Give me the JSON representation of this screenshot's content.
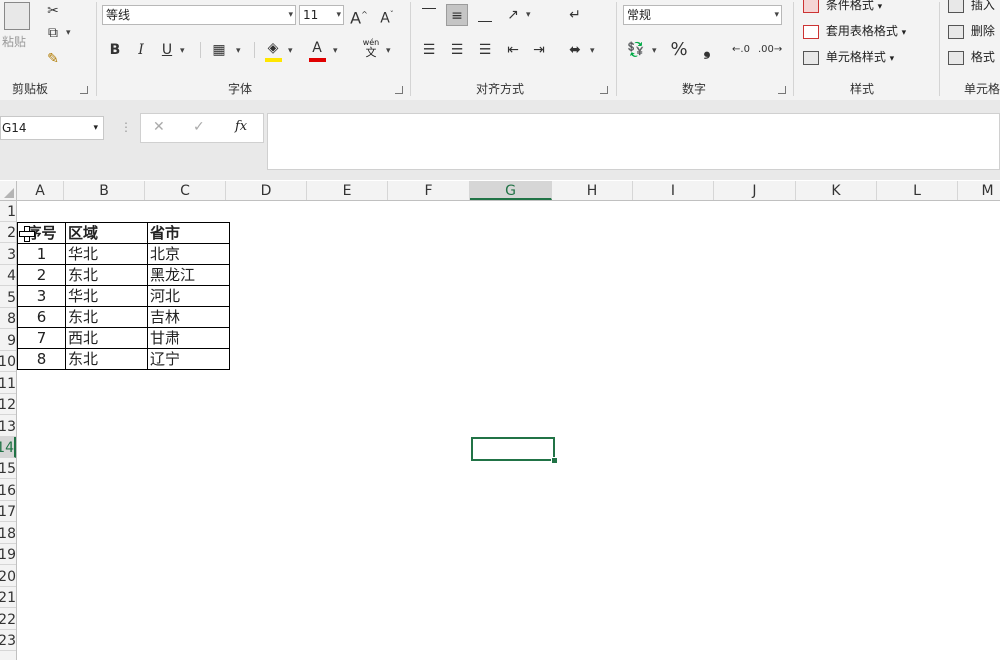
{
  "ribbon": {
    "clipboard": {
      "paste_label": "粘贴",
      "group_label": "剪贴板"
    },
    "font": {
      "family": "等线",
      "size": "11",
      "grow": "A",
      "shrink": "A",
      "bold": "B",
      "italic": "I",
      "underline": "U",
      "phonetic_top": "wén",
      "phonetic_bottom": "文",
      "group_label": "字体"
    },
    "alignment": {
      "group_label": "对齐方式"
    },
    "number": {
      "format": "常规",
      "percent": "%",
      "comma": "❟",
      "group_label": "数字"
    },
    "styles": {
      "conditional": "条件格式",
      "table_format": "套用表格格式",
      "cell_styles": "单元格样式",
      "group_label": "样式"
    },
    "cells": {
      "insert": "插入",
      "delete": "删除",
      "format": "格式",
      "group_label": "单元格"
    }
  },
  "formula_bar": {
    "name_box": "G14",
    "cancel": "✕",
    "enter": "✓",
    "fx": "fx",
    "formula": ""
  },
  "columns": [
    "A",
    "B",
    "C",
    "D",
    "E",
    "F",
    "G",
    "H",
    "I",
    "J",
    "K",
    "L",
    "M"
  ],
  "active_column": "G",
  "rows": [
    "1",
    "2",
    "3",
    "4",
    "5",
    "8",
    "9",
    "10",
    "11",
    "12",
    "13",
    "14",
    "15",
    "16",
    "17",
    "18",
    "19",
    "20",
    "21",
    "22",
    "23"
  ],
  "active_row": "14",
  "table": {
    "headers": [
      "序号",
      "区域",
      "省市"
    ],
    "rows": [
      [
        "1",
        "华北",
        "北京"
      ],
      [
        "2",
        "东北",
        "黑龙江"
      ],
      [
        "3",
        "华北",
        "河北"
      ],
      [
        "6",
        "东北",
        "吉林"
      ],
      [
        "7",
        "西北",
        "甘肃"
      ],
      [
        "8",
        "东北",
        "辽宁"
      ]
    ]
  },
  "colors": {
    "accent": "#217346",
    "font_color": "#e00000",
    "highlight": "#ffe600"
  }
}
